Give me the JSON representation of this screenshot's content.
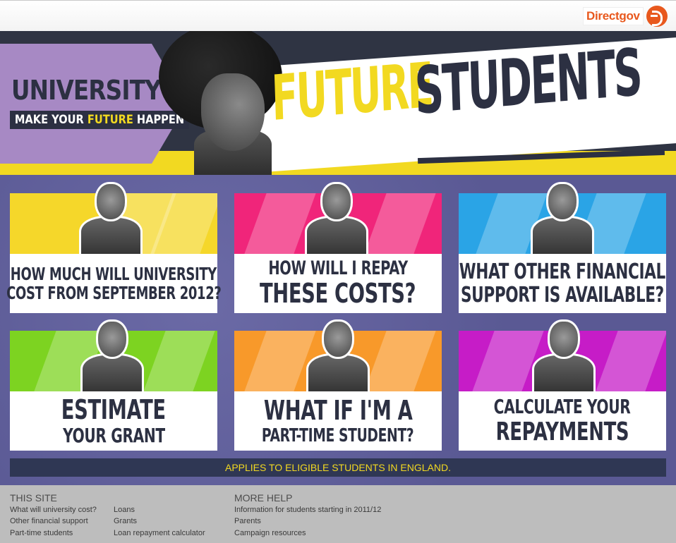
{
  "header": {
    "brand_label": "Directgov",
    "colors": {
      "brand": "#e8581d",
      "yellow": "#f2d921",
      "navy": "#2c3042",
      "purple": "#a789c4"
    }
  },
  "hero": {
    "university_label": "UNIVERSITY",
    "tagline_part1": "MAKE YOUR ",
    "tagline_highlight": "FUTURE",
    "tagline_part2": " HAPPEN",
    "title_word1": "FUTURE",
    "title_word2": "STUDENTS"
  },
  "tiles": [
    {
      "line1": "HOW MUCH WILL UNIVERSITY",
      "line2": "COST FROM SEPTEMBER 2012?",
      "color": "#f5d72a",
      "icon": "student-portrait-icon"
    },
    {
      "line1": "HOW WILL I REPAY",
      "line2": "THESE COSTS?",
      "color": "#f0257a",
      "icon": "student-portrait-icon"
    },
    {
      "line1": "WHAT OTHER FINANCIAL",
      "line2": "SUPPORT IS AVAILABLE?",
      "color": "#2aa4e6",
      "icon": "student-portrait-icon"
    },
    {
      "line1": "ESTIMATE",
      "line2": "YOUR GRANT",
      "color": "#7dd321",
      "icon": "student-portrait-icon"
    },
    {
      "line1": "WHAT IF I'M A",
      "line2": "PART-TIME STUDENT?",
      "color": "#f8992a",
      "icon": "student-portrait-icon"
    },
    {
      "line1": "CALCULATE YOUR",
      "line2": "REPAYMENTS",
      "color": "#c61cc7",
      "icon": "student-portrait-icon"
    }
  ],
  "notice": "APPLIES TO ELIGIBLE STUDENTS IN ENGLAND.",
  "footer": {
    "this_site_heading": "THIS SITE",
    "this_site_col1": [
      "What will university cost?",
      "Other financial support",
      "Part-time students"
    ],
    "this_site_col2": [
      "Loans",
      "Grants",
      "Loan repayment calculator"
    ],
    "more_help_heading": "MORE HELP",
    "more_help_links": [
      "Information for students starting in 2011/12",
      "Parents",
      "Campaign resources"
    ]
  }
}
